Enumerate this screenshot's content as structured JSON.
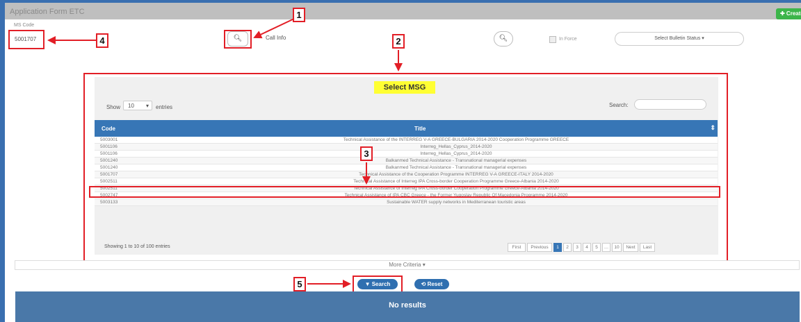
{
  "header": {
    "app_title": "Application Form ETC",
    "create_label": "✚ Create"
  },
  "filters": {
    "ms_code_label": "MS Code",
    "ms_code_value": "5001707",
    "call_placeholder": "Call Info",
    "in_force_label": "In Force",
    "bulletin_status": "Select Bulletin Status ▾"
  },
  "modal": {
    "title": "Select MSG",
    "show_label": "Show",
    "entries_value": "10",
    "entries_label": "entries",
    "search_label": "Search:",
    "columns": {
      "code": "Code",
      "title": "Title"
    },
    "rows": [
      {
        "code": "5003001",
        "title": "Technical Assistance of the INTERREG V-A GREECE-BULGARIA 2014-2020 Cooperation Programme GREECE"
      },
      {
        "code": "5001106",
        "title": "Interreg_Hellas_Cyprus_2014-2020"
      },
      {
        "code": "5001106",
        "title": "Interreg_Hellas_Cyprus_2014-2020"
      },
      {
        "code": "5001240",
        "title": "Balkanmed Technical Assistance - Transnational managerial expenses"
      },
      {
        "code": "5001240",
        "title": "Balkanmed Technical Assistance - Transnational managerial expenses"
      },
      {
        "code": "5001707",
        "title": "Technical Assistance of the Cooperation Programme INTERREG V-A GREECE-ITALY 2014-2020"
      },
      {
        "code": "5002511",
        "title": "Technical Assistance of Interreg IPA Cross-border Cooperation Programme Greece-Albania 2014-2020"
      },
      {
        "code": "5002511",
        "title": "Technical Assistance of Interreg IPA Cross-border Cooperation Programme Greece-Albania 2014-2020"
      },
      {
        "code": "5002747",
        "title": "Technical Assistance of IPA CBC Greece - the Former Yugoslav Republic Of Macedonia Programme 2014-2020"
      },
      {
        "code": "5003133",
        "title": "Sustainable WATER supply networks in Mediterranean touristic areas"
      }
    ],
    "showing": "Showing 1 to 10 of 100 entries",
    "pager": [
      "First",
      "Previous",
      "1",
      "2",
      "3",
      "4",
      "5",
      "…",
      "10",
      "Next",
      "Last"
    ]
  },
  "more_criteria": "More Criteria ▾",
  "buttons": {
    "search": "Search",
    "reset": "Reset"
  },
  "results_text": "No results",
  "callouts": [
    "1",
    "2",
    "3",
    "4",
    "5"
  ],
  "colors": {
    "callout_red": "#e21e26",
    "primary_blue": "#3776b6",
    "create_green": "#3cb54a",
    "highlight_yellow": "#ffff33"
  }
}
